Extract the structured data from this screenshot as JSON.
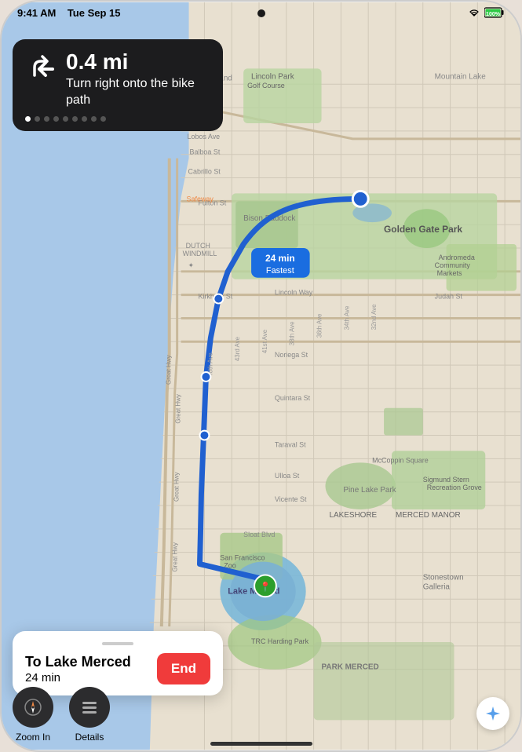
{
  "device": {
    "status_bar": {
      "time": "9:41 AM",
      "date": "Tue Sep 15",
      "battery": "100%"
    }
  },
  "navigation": {
    "distance": "0.4 mi",
    "instruction": "Turn right onto the bike path",
    "dots": [
      true,
      false,
      false,
      false,
      false,
      false,
      false,
      false,
      false
    ]
  },
  "route_label": {
    "time": "24 min",
    "badge": "Fastest"
  },
  "bottom_panel": {
    "handle": "",
    "to_label": "To Lake Merced",
    "time": "24 min",
    "end_button": "End"
  },
  "controls": {
    "zoom_in": "Zoom In",
    "details": "Details"
  },
  "map": {
    "ocean_color": "#a8c8e8",
    "land_color": "#e8e0d0"
  }
}
